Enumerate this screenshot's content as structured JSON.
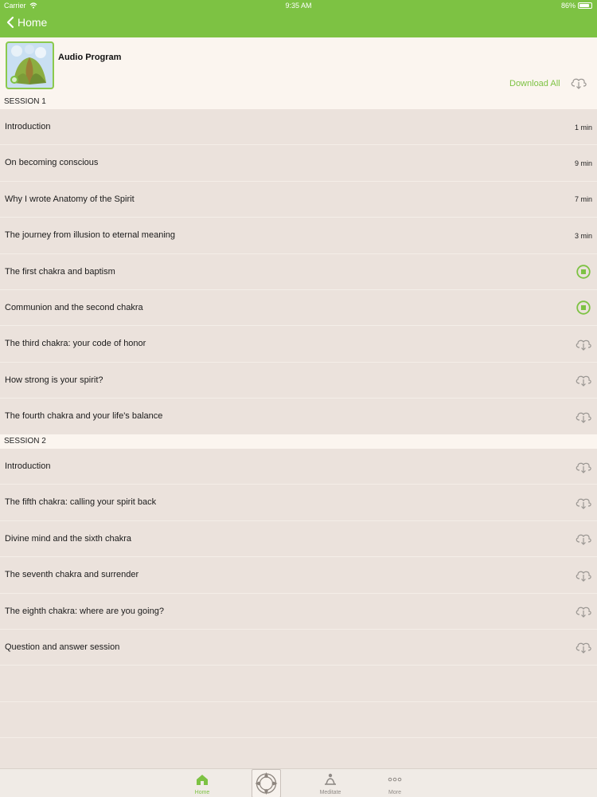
{
  "status_bar": {
    "carrier": "Carrier",
    "time": "9:35 AM",
    "battery": "86%",
    "battery_level": 0.86
  },
  "nav": {
    "back_label": "Home"
  },
  "header": {
    "title": "Audio Program",
    "download_all_label": "Download All"
  },
  "colors": {
    "accent": "#7dc243",
    "row_bg": "#ebe2dc",
    "header_bg": "#fbf5ef"
  },
  "sessions": [
    {
      "title": "SESSION 1",
      "tracks": [
        {
          "title": "Introduction",
          "state": "time",
          "time": "1 min"
        },
        {
          "title": "On becoming conscious",
          "state": "time",
          "time": "9 min"
        },
        {
          "title": "Why I wrote Anatomy of the Spirit",
          "state": "time",
          "time": "7 min"
        },
        {
          "title": "The journey from illusion to eternal meaning",
          "state": "time",
          "time": "3 min"
        },
        {
          "title": "The first chakra and baptism",
          "state": "downloading"
        },
        {
          "title": "Communion and the second chakra",
          "state": "downloading"
        },
        {
          "title": "The third chakra: your code of honor",
          "state": "cloud"
        },
        {
          "title": "How strong is your spirit?",
          "state": "cloud"
        },
        {
          "title": "The fourth chakra and your life's balance",
          "state": "cloud"
        }
      ]
    },
    {
      "title": "SESSION 2",
      "tracks": [
        {
          "title": "Introduction",
          "state": "cloud"
        },
        {
          "title": "The fifth chakra: calling your spirit back",
          "state": "cloud"
        },
        {
          "title": "Divine mind and the sixth chakra",
          "state": "cloud"
        },
        {
          "title": "The seventh chakra and surrender",
          "state": "cloud"
        },
        {
          "title": "The eighth chakra: where are you going?",
          "state": "cloud"
        },
        {
          "title": "Question and answer session",
          "state": "cloud"
        }
      ]
    }
  ],
  "tab_bar": {
    "home": "Home",
    "meditate": "Meditate",
    "more": "More"
  },
  "icons": {
    "back": "chevron-left-icon",
    "download": "cloud-download-icon",
    "stop": "stop-download-icon",
    "home": "home-icon",
    "center": "mandala-icon",
    "meditate": "meditate-icon",
    "more": "more-icon"
  }
}
